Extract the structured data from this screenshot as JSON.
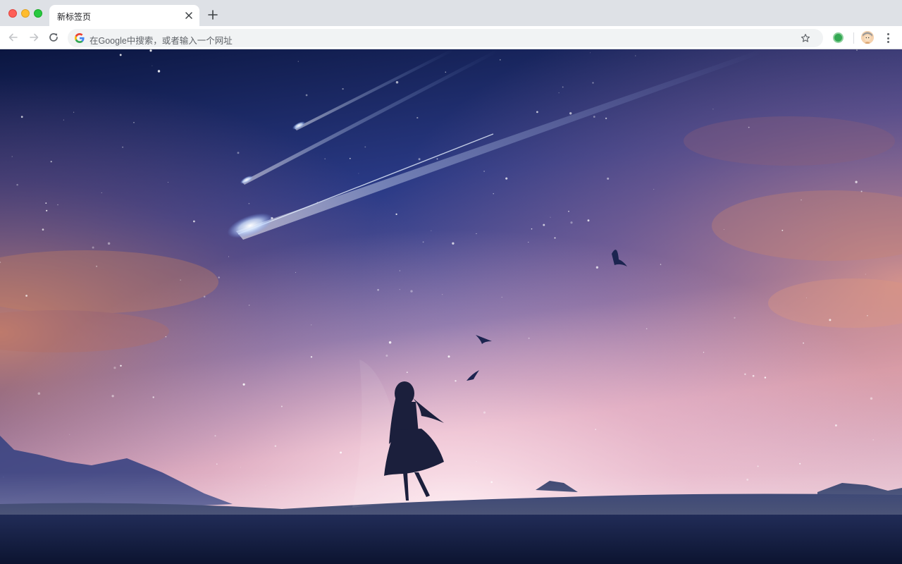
{
  "window": {
    "controls": [
      "close",
      "minimize",
      "maximize"
    ]
  },
  "tabs": [
    {
      "title": "新标签页",
      "active": true,
      "close_icon": "close-icon"
    }
  ],
  "new_tab_icon": "plus-icon",
  "toolbar": {
    "back_icon": "arrow-left-icon",
    "forward_icon": "arrow-right-icon",
    "reload_icon": "reload-icon",
    "bookmark_icon": "star-icon",
    "extension_icon": "extension-green-circle-icon",
    "profile_icon": "avatar-icon",
    "menu_icon": "kebab-menu-icon"
  },
  "omnibox": {
    "placeholder": "在Google中搜索，或者输入一个网址",
    "engine_icon": "google-g-icon"
  },
  "wallpaper": {
    "description_icon": "anime-night-sky-wallpaper",
    "colors": {
      "sky_top": "#0b1640",
      "sky_mid": "#2a3a86",
      "horizon_pink": "#e9b7c8",
      "horizon_glow": "#f6d9e2",
      "ground": "#0c1430",
      "meteor": "#e8f2ff"
    }
  }
}
